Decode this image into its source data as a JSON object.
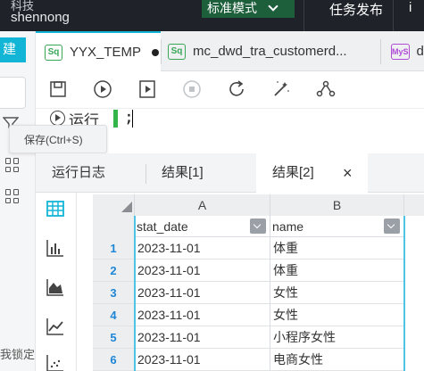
{
  "header": {
    "app_line1": "科技",
    "app_line2": "shennong",
    "mode": "标准模式",
    "task_publish": "任务发布",
    "right_cut": "i"
  },
  "sidebar": {
    "new_label": "建",
    "lock_label": "我锁定"
  },
  "tabs": [
    {
      "badge": "Sq",
      "label": "YYX_TEMP",
      "active": true,
      "unsaved": true
    },
    {
      "badge": "Sq",
      "label": "mc_dwd_tra_customerd...",
      "active": false
    },
    {
      "badge": "MyS",
      "label": "dv",
      "active": false
    }
  ],
  "toolbar": {
    "icons": [
      "save-icon",
      "run-icon",
      "run-selected-icon",
      "stop-icon",
      "refresh-icon",
      "format-icon",
      "share-icon"
    ]
  },
  "editor": {
    "run_label": "运行",
    "code": ";"
  },
  "tooltip": {
    "text": "保存(Ctrl+S)"
  },
  "result_tabs": [
    {
      "label": "运行日志",
      "active": false
    },
    {
      "label": "结果[1]",
      "active": false
    },
    {
      "label": "结果[2]",
      "active": true,
      "close": "×"
    }
  ],
  "result_side_icons": [
    "table-view-icon",
    "bar-chart-icon",
    "area-chart-icon",
    "line-chart-icon",
    "scatter-chart-icon"
  ],
  "table": {
    "col_letters": [
      "A",
      "B"
    ],
    "fields": [
      "stat_date",
      "name"
    ],
    "rows": [
      {
        "num": "1",
        "stat_date": "2023-11-01",
        "name": "体重"
      },
      {
        "num": "2",
        "stat_date": "2023-11-01",
        "name": "体重"
      },
      {
        "num": "3",
        "stat_date": "2023-11-01",
        "name": "女性"
      },
      {
        "num": "4",
        "stat_date": "2023-11-01",
        "name": "女性"
      },
      {
        "num": "5",
        "stat_date": "2023-11-01",
        "name": "小程序女性"
      },
      {
        "num": "6",
        "stat_date": "2023-11-01",
        "name": "电商女性"
      }
    ]
  },
  "colors": {
    "accent": "#13b5d6",
    "mode_bg": "#1d5f3b",
    "topbar": "#1f2329",
    "row_number": "#1e86d6"
  }
}
